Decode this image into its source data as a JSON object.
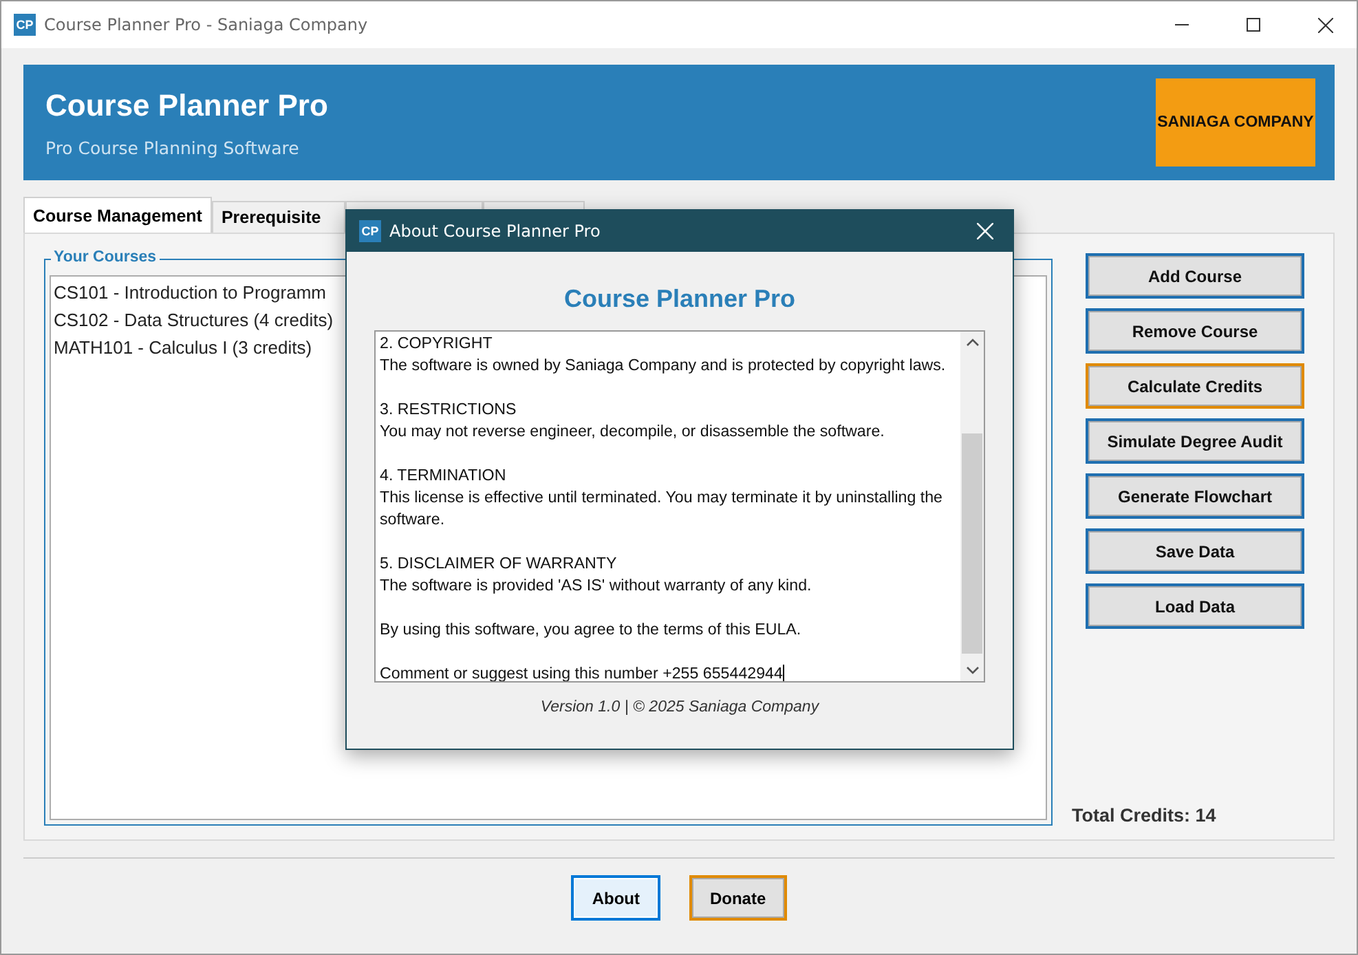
{
  "window": {
    "title": "Course Planner Pro - Saniaga Company",
    "icon_text": "CP"
  },
  "header": {
    "title": "Course Planner Pro",
    "subtitle": "Pro Course Planning Software",
    "logo": "SANIAGA COMPANY"
  },
  "tabs": [
    {
      "label": "Course Management",
      "selected": true
    },
    {
      "label": "Prerequisite",
      "selected": false
    },
    {
      "selected": false
    },
    {
      "selected": false
    }
  ],
  "courses": {
    "title": "Your Courses",
    "items": [
      "CS101 - Introduction to Programm",
      "CS102 - Data Structures (4 credits)",
      "MATH101 - Calculus I (3 credits)"
    ]
  },
  "actions": [
    {
      "label": "Add Course",
      "color": "#1f6fb0"
    },
    {
      "label": "Remove Course",
      "color": "#1f6fb0"
    },
    {
      "label": "Calculate Credits",
      "color": "#e08a00"
    },
    {
      "label": "Simulate Degree Audit",
      "color": "#1f6fb0"
    },
    {
      "label": "Generate Flowchart",
      "color": "#1f6fb0"
    },
    {
      "label": "Save Data",
      "color": "#1f6fb0"
    },
    {
      "label": "Load Data",
      "color": "#1f6fb0"
    }
  ],
  "total_credits": "Total Credits: 14",
  "bottom_buttons": [
    {
      "label": "About",
      "color": "#0078d7",
      "focused": true
    },
    {
      "label": "Donate",
      "color": "#e08a00",
      "focused": false
    }
  ],
  "dialog": {
    "title": "About Course Planner Pro",
    "icon_text": "CP",
    "heading": "Course Planner Pro",
    "sections": [
      {
        "heading": "2. COPYRIGHT",
        "body": "The software is owned by Saniaga Company and is protected by copyright laws."
      },
      {
        "heading": "3. RESTRICTIONS",
        "body": "You may not reverse engineer, decompile, or disassemble the software."
      },
      {
        "heading": "4. TERMINATION",
        "body": "This license is effective until terminated. You may terminate it by uninstalling the software."
      },
      {
        "heading": "5. DISCLAIMER OF WARRANTY",
        "body": "The software is provided 'AS IS' without warranty of any kind."
      },
      {
        "body": "By using this software, you agree to the terms of this EULA."
      },
      {
        "body": "Comment or suggest using this number +255 655442944"
      }
    ],
    "footer": "Version 1.0 | © 2025 Saniaga Company"
  }
}
